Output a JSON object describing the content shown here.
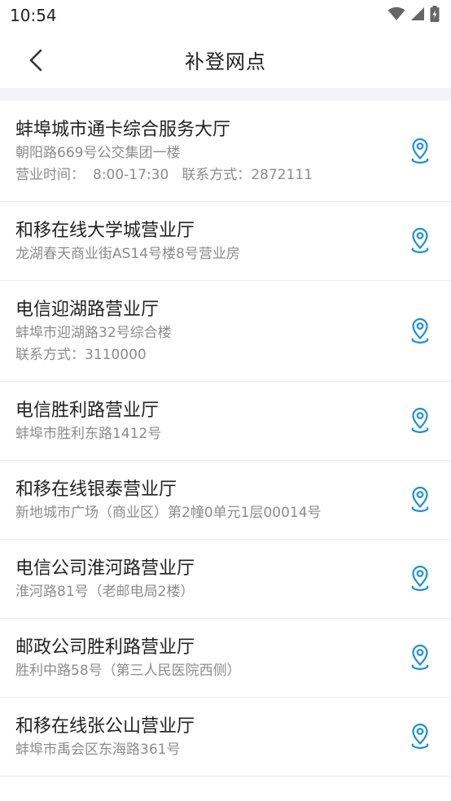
{
  "status_bar": {
    "time": "10:54",
    "icons": [
      "wifi-icon",
      "signal-icon",
      "battery-charging-icon"
    ]
  },
  "header": {
    "title": "补登网点",
    "back_icon": "chevron-left-icon"
  },
  "colors": {
    "accent": "#1a8fe3",
    "title_text": "#222222",
    "secondary_text": "#8c8c8c",
    "divider": "#ececec",
    "band": "#f4f4f6"
  },
  "outlets": [
    {
      "name": "蚌埠城市通卡综合服务大厅",
      "address": "朝阳路669号公交集团一楼",
      "hours_label": "营业时间：",
      "hours": "8:00-17:30",
      "contact_label": "联系方式：",
      "contact": "2872111"
    },
    {
      "name": "和移在线大学城营业厅",
      "address": "龙湖春天商业街AS14号楼8号营业房"
    },
    {
      "name": "电信迎湖路营业厅",
      "address": "蚌埠市迎湖路32号综合楼",
      "contact_label": "联系方式：",
      "contact": "3110000"
    },
    {
      "name": "电信胜利路营业厅",
      "address": "蚌埠市胜利东路1412号"
    },
    {
      "name": "和移在线银泰营业厅",
      "address": "新地城市广场（商业区）第2幢0单元1层00014号"
    },
    {
      "name": "电信公司淮河路营业厅",
      "address": "淮河路81号（老邮电局2楼）"
    },
    {
      "name": "邮政公司胜利路营业厅",
      "address": "胜利中路58号（第三人民医院西侧）"
    },
    {
      "name": "和移在线张公山营业厅",
      "address": "蚌埠市禹会区东海路361号"
    }
  ]
}
